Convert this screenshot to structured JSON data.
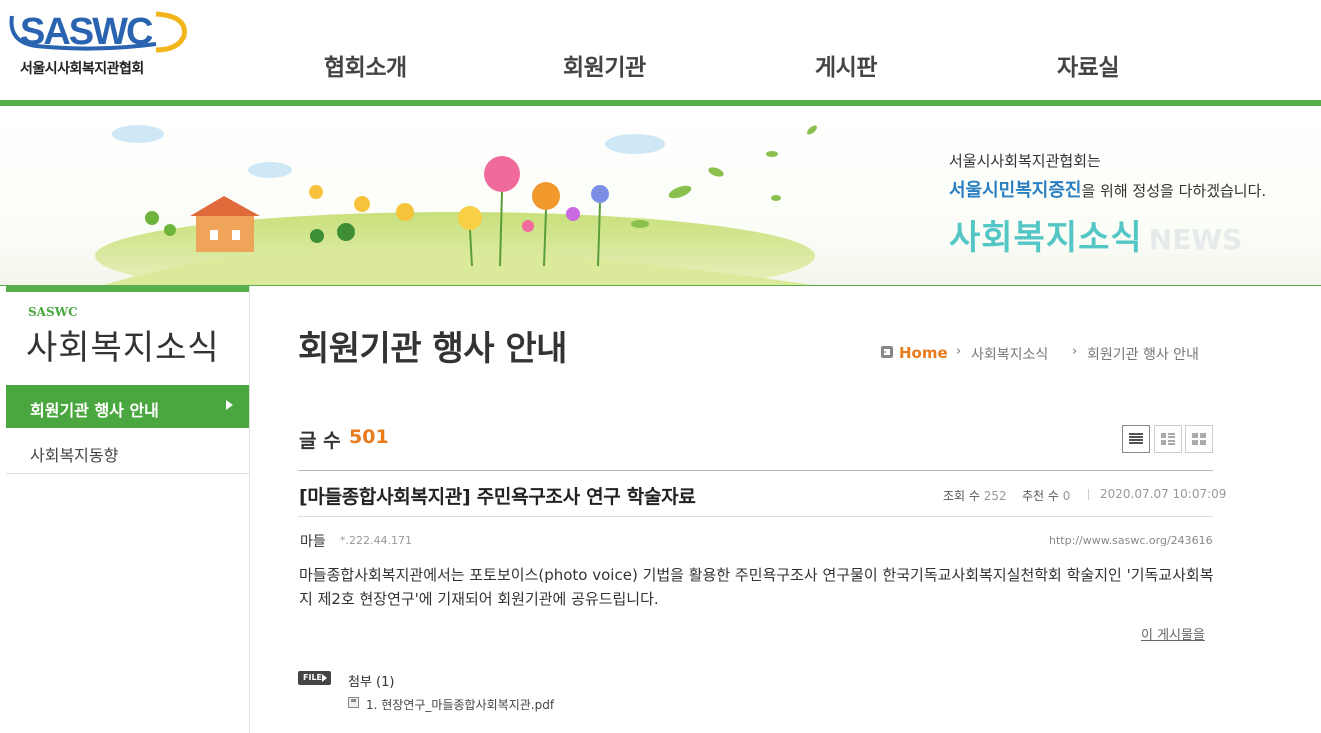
{
  "header": {
    "logo_text": "SASWC",
    "logo_subtitle": "서울시사회복지관협회",
    "nav": [
      "협회소개",
      "회원기관",
      "게시판",
      "자료실"
    ]
  },
  "banner": {
    "line1": "서울시사회복지관협회는",
    "line2_highlight": "서울시민복지증진",
    "line2_rest": "을 위해 정성을 다하겠습니다.",
    "title": "사회복지소식",
    "title_en": "NEWS"
  },
  "sidebar": {
    "brand": "SASWC",
    "title": "사회복지소식",
    "items": [
      {
        "label": "회원기관 행사 안내",
        "active": true
      },
      {
        "label": "사회복지동향",
        "active": false
      }
    ]
  },
  "page": {
    "title": "회원기관 행사 안내",
    "breadcrumb": {
      "home": "Home",
      "items": [
        "사회복지소식",
        "회원기관 행사 안내"
      ]
    }
  },
  "board": {
    "count_label": "글 수",
    "count": "501"
  },
  "post": {
    "title": "[마들종합사회복지관] 주민욕구조사 연구 학술자료",
    "views_label": "조회 수",
    "views": "252",
    "recommend_label": "추천 수",
    "recommend": "0",
    "datetime": "2020.07.07 10:07:09",
    "author": "마들",
    "ip": "*.222.44.171",
    "permalink": "http://www.saswc.org/243616",
    "body": "마들종합사회복지관에서는 포토보이스(photo voice) 기법을 활용한 주민욕구조사 연구물이 한국기독교사회복지실천학회 학술지인 '기독교사회복지 제2호 현장연구'에 기재되어 회원기관에 공유드립니다.",
    "more_link": "이 게시물을",
    "file_badge": "FILE",
    "attachment_label": "첨부 (1)",
    "attachments": [
      "1. 현장연구_마들종합사회복지관.pdf"
    ]
  },
  "colors": {
    "brand_green": "#5aad4c",
    "accent_orange": "#e87b1c",
    "banner_teal": "#55c6c6",
    "banner_blue": "#2a7fc1"
  }
}
